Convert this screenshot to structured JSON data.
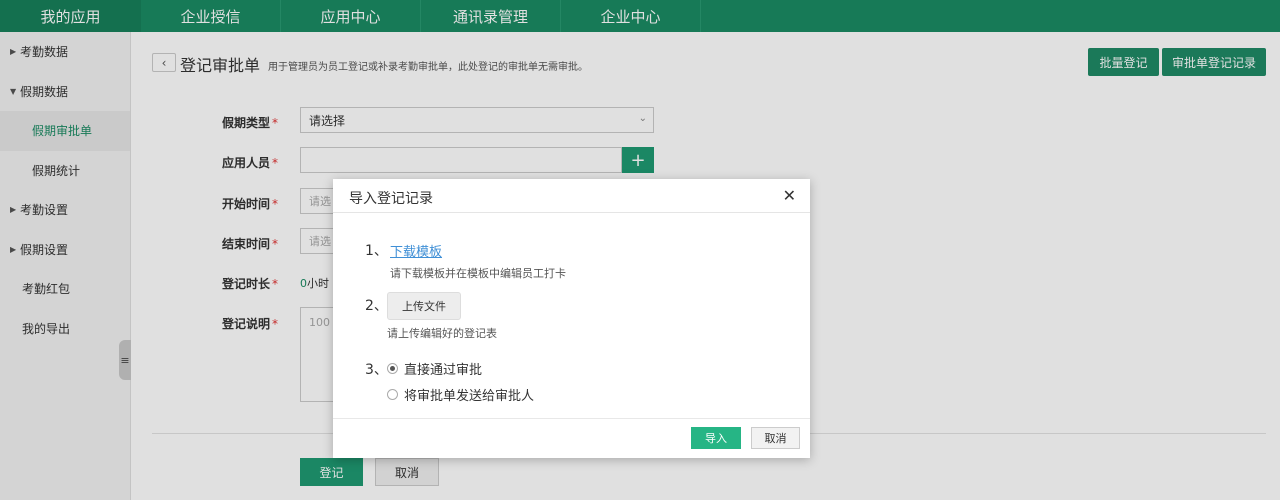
{
  "topnav": {
    "brand": "我的应用",
    "items": [
      "企业授信",
      "应用中心",
      "通讯录管理",
      "企业中心"
    ]
  },
  "sidebar": {
    "items": [
      {
        "label": "考勤数据",
        "caret": "▶"
      },
      {
        "label": "假期数据",
        "caret": "▼"
      },
      {
        "label": "假期审批单"
      },
      {
        "label": "假期统计"
      },
      {
        "label": "考勤设置",
        "caret": "▶"
      },
      {
        "label": "假期设置",
        "caret": "▶"
      },
      {
        "label": "考勤红包"
      },
      {
        "label": "我的导出"
      }
    ],
    "handle_icon": "≡"
  },
  "header": {
    "back_icon": "‹",
    "title": "登记审批单",
    "desc": "用于管理员为员工登记或补录考勤审批单，此处登记的审批单无需审批。",
    "batch_btn": "批量登记",
    "record_btn": "审批单登记记录"
  },
  "form": {
    "type_label": "假期类型",
    "type_value": "请选择",
    "person_label": "应用人员",
    "plus_icon": "+",
    "start_label": "开始时间",
    "start_placeholder": "请选",
    "end_label": "结束时间",
    "end_placeholder": "请选",
    "duration_label": "登记时长",
    "duration_num": "0",
    "duration_unit": "小时",
    "note_label": "登记说明",
    "note_placeholder": "100",
    "required_mark": "*",
    "submit": "登记",
    "cancel": "取消"
  },
  "modal": {
    "title": "导入登记记录",
    "close_icon": "✕",
    "step1_num": "1、",
    "step1_link": "下载模板",
    "step1_hint": "请下载模板并在模板中编辑员工打卡",
    "step2_num": "2、",
    "step2_btn": "上传文件",
    "step2_hint": "请上传编辑好的登记表",
    "step3_num": "3、",
    "option1": "直接通过审批",
    "option2": "将审批单发送给审批人",
    "import_btn": "导入",
    "cancel_btn": "取消"
  },
  "colors": {
    "nav": "#1b8b63",
    "accent": "#1f9a72",
    "link": "#3f8fd6",
    "required": "#e03030"
  }
}
